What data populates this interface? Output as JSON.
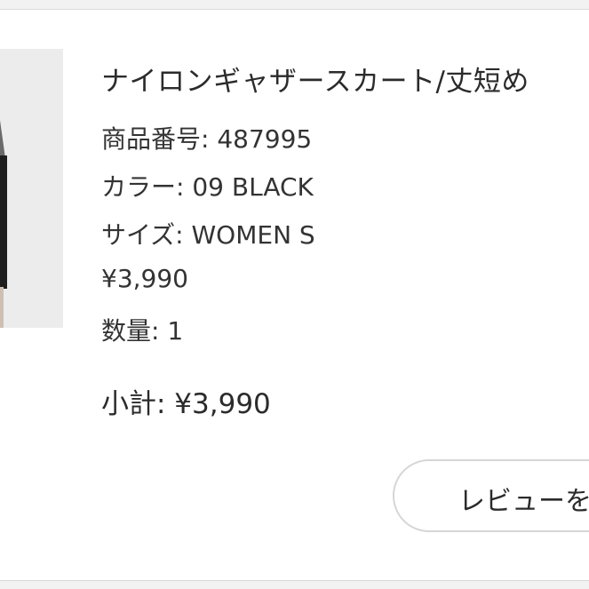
{
  "item": {
    "title": "ナイロンギャザースカート/丈短め",
    "product_number": "商品番号: 487995",
    "color": "カラー: 09 BLACK",
    "size": "サイズ: WOMEN S",
    "price": "¥3,990",
    "quantity": "数量: 1",
    "subtotal": "小計: ¥3,990"
  },
  "actions": {
    "review_label": "レビューを書く"
  }
}
